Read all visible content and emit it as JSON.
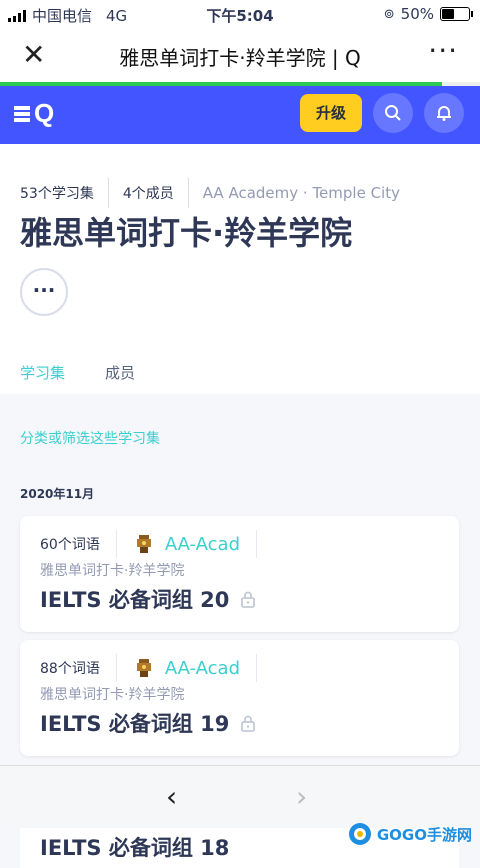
{
  "status_bar": {
    "carrier": "中国电信",
    "network": "4G",
    "time": "下午5:04",
    "battery": "50%"
  },
  "webview_bar": {
    "title": "雅思单词打卡·羚羊学院 | Q",
    "page_load_progress": 0.92
  },
  "app_nav": {
    "logo": "Q",
    "upgrade_label": "升级",
    "accent_color": "#4255ff",
    "upgrade_color": "#ffcd1f"
  },
  "class_header": {
    "set_count": "53个学习集",
    "member_count": "4个成员",
    "organization": "AA Academy · Temple City",
    "class_name": "雅思单词打卡·羚羊学院",
    "more_label": "···",
    "tabs": [
      {
        "label": "学习集",
        "active": true
      },
      {
        "label": "成员",
        "active": false
      }
    ]
  },
  "filter_link": "分类或筛选这些学习集",
  "month_label": "2020年11月",
  "sets": [
    {
      "term_count": "60个词语",
      "creator": "AA-Acad",
      "class": "雅思单词打卡·羚羊学院",
      "name": "IELTS 必备词组 20",
      "locked": true
    },
    {
      "term_count": "88个词语",
      "creator": "AA-Acad",
      "class": "雅思单词打卡·羚羊学院",
      "name": "IELTS 必备词组 19",
      "locked": true
    },
    {
      "name": "IELTS 必备词组 18"
    }
  ],
  "bottom_nav": {
    "back": "‹",
    "forward": "›"
  },
  "watermark": "GOGO手游网"
}
